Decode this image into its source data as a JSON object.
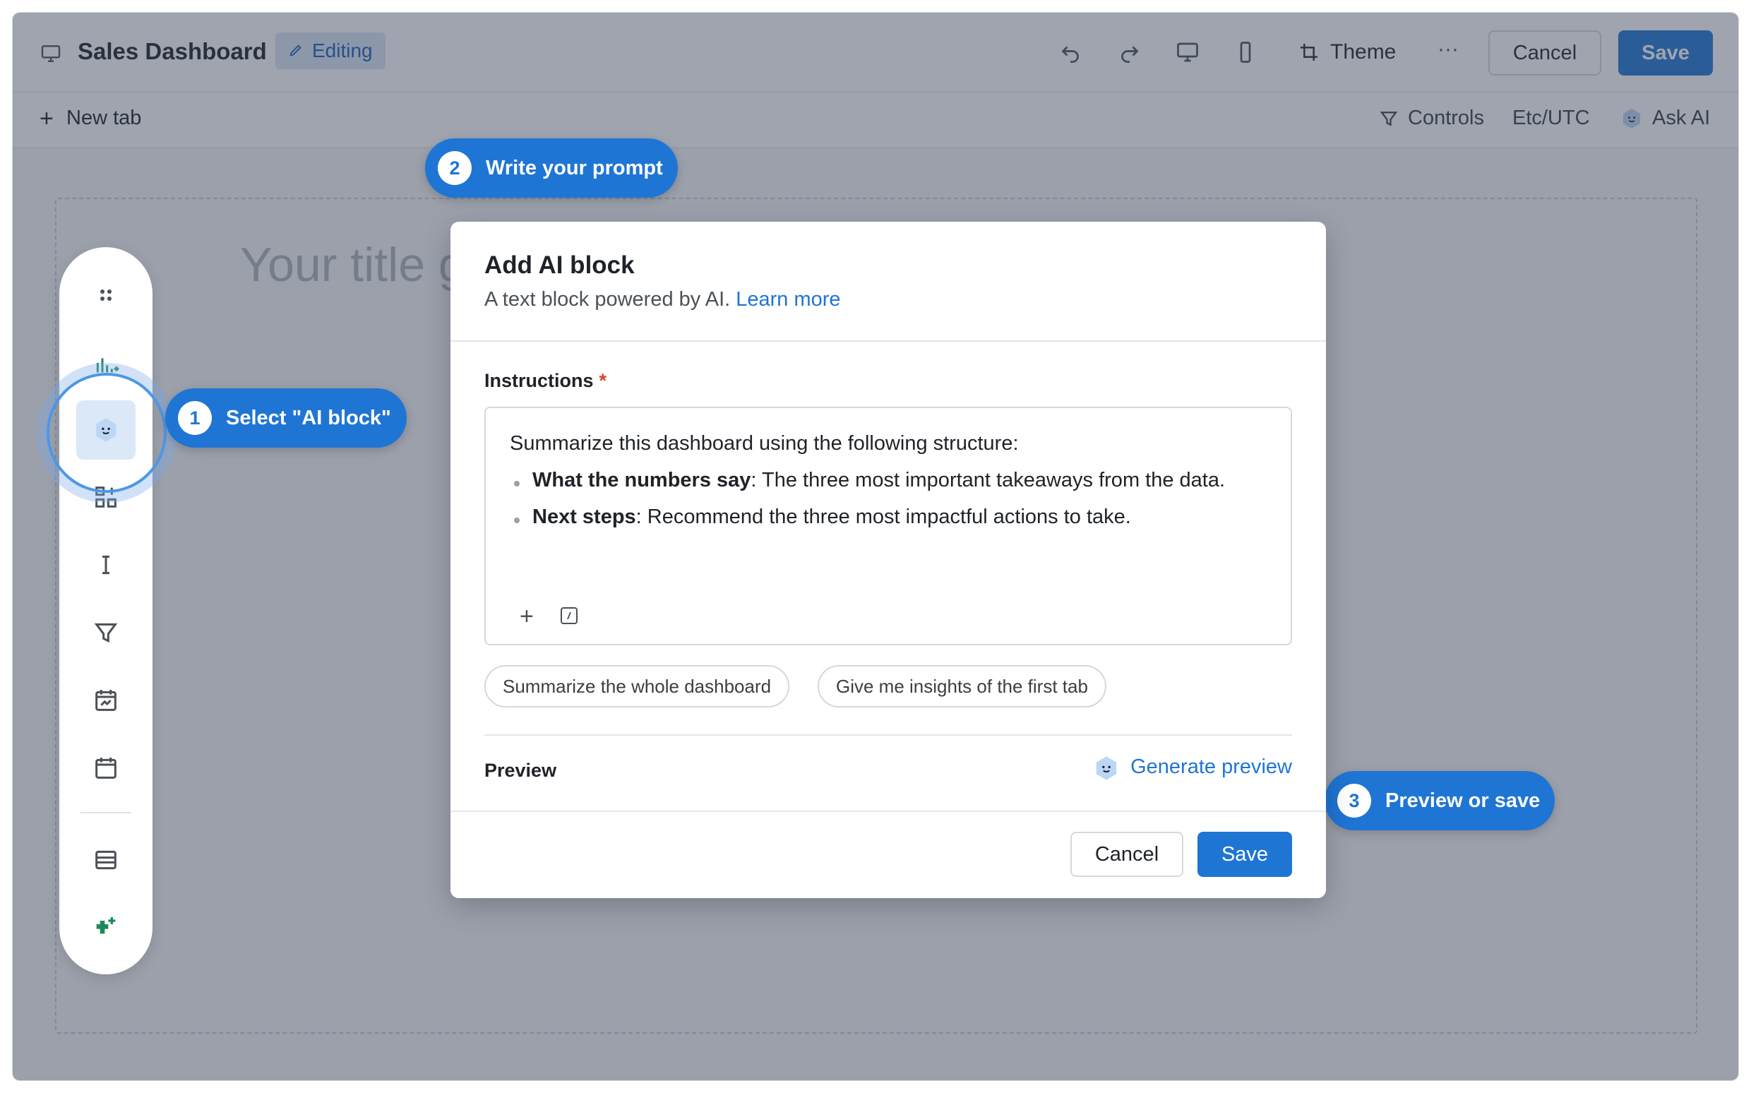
{
  "header": {
    "title": "Sales Dashboard",
    "editing_label": "Editing",
    "theme_label": "Theme",
    "more_label": "···",
    "cancel_label": "Cancel",
    "save_label": "Save"
  },
  "subbar": {
    "new_tab_label": "New tab",
    "controls_label": "Controls",
    "timezone_label": "Etc/UTC",
    "ask_ai_label": "Ask AI"
  },
  "canvas": {
    "title_placeholder": "Your title g"
  },
  "callouts": [
    {
      "num": "1",
      "label": "Select \"AI block\""
    },
    {
      "num": "2",
      "label": "Write your prompt"
    },
    {
      "num": "3",
      "label": "Preview or save"
    }
  ],
  "modal": {
    "title": "Add AI block",
    "subtitle": "A text block powered by AI.",
    "learn_more": "Learn more",
    "instructions_label": "Instructions",
    "required_mark": "*",
    "instructions": {
      "intro": "Summarize this dashboard using the following structure:",
      "bullets": [
        {
          "bold": "What the numbers say",
          "rest": ": The three most important takeaways from the data."
        },
        {
          "bold": "Next steps",
          "rest": ": Recommend the three most impactful actions to take."
        }
      ]
    },
    "suggestions": [
      "Summarize the whole dashboard",
      "Give me insights of the first tab"
    ],
    "preview_label": "Preview",
    "generate_preview_label": "Generate preview",
    "cancel_label": "Cancel",
    "save_label": "Save"
  },
  "colors": {
    "accent": "#1f75d4",
    "editing_bg": "#dbe7f6",
    "required": "#d6402b",
    "overlay": "#374155"
  }
}
